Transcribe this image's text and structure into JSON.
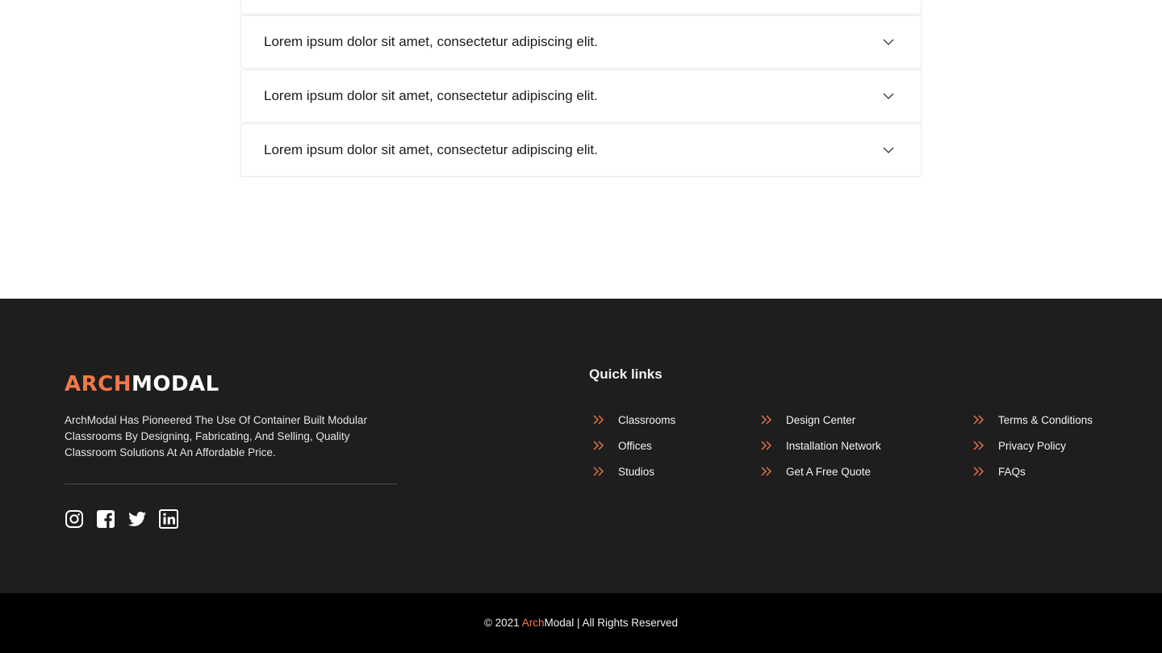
{
  "faq": {
    "items": [
      {
        "question": ""
      },
      {
        "question": "Lorem ipsum dolor sit amet, consectetur adipiscing elit."
      },
      {
        "question": "Lorem ipsum dolor sit amet, consectetur adipiscing elit."
      },
      {
        "question": "Lorem ipsum dolor sit amet, consectetur adipiscing elit."
      }
    ],
    "chevron_icon": "chevron-down-icon"
  },
  "footer": {
    "logo": {
      "part1": "ARCH",
      "part2": "MODAL"
    },
    "about": "ArchModal Has Pioneered The Use Of Container Built Modular Classrooms By Designing, Fabricating, And Selling, Quality Classroom Solutions At An Affordable Price.",
    "socials": [
      "instagram-icon",
      "facebook-icon",
      "twitter-icon",
      "linkedin-icon"
    ],
    "quick_links_title": "Quick links",
    "columns": [
      [
        "Classrooms",
        "Offices",
        "Studios"
      ],
      [
        "Design Center",
        "Installation Network",
        "Get A Free Quote"
      ],
      [
        "Terms & Conditions",
        "Privacy Policy",
        "FAQs"
      ]
    ],
    "link_icon": "double-chevron-right-icon"
  },
  "copyright": {
    "prefix": "© 2021 ",
    "accent": "Arch",
    "suffix": "Modal | All Rights Reserved"
  },
  "colors": {
    "accent": "#f0784a",
    "footer_bg": "#1e1e1f",
    "bottom_bar_bg": "#000000"
  }
}
